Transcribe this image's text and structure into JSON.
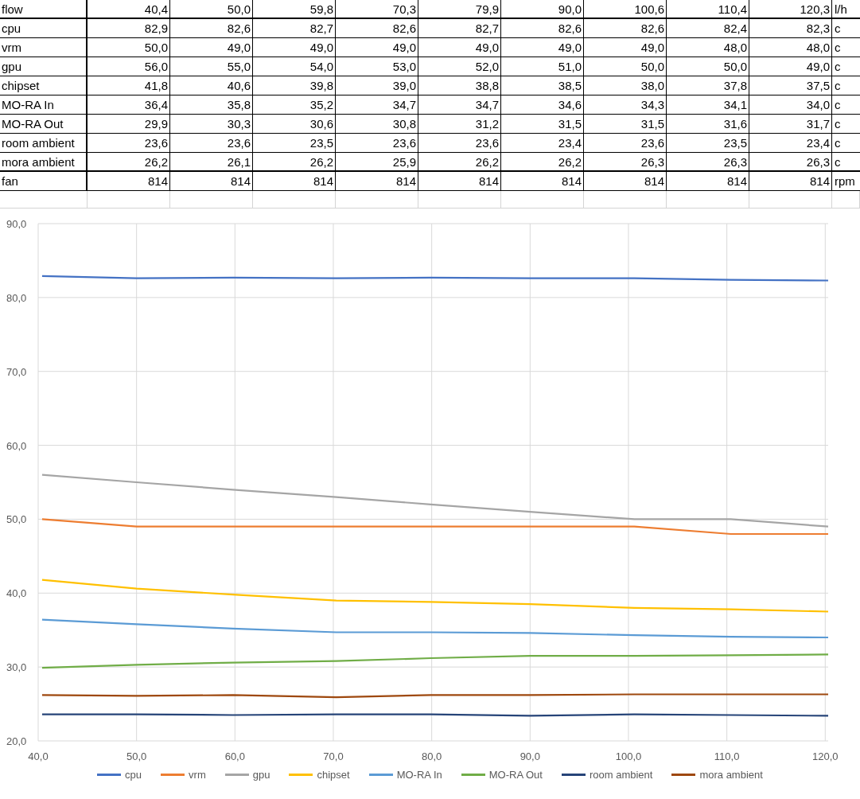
{
  "table": {
    "rows": [
      {
        "label": "flow",
        "values": [
          "40,4",
          "50,0",
          "59,8",
          "70,3",
          "79,9",
          "90,0",
          "100,6",
          "110,4",
          "120,3"
        ],
        "unit": "l/h"
      },
      {
        "label": "cpu",
        "values": [
          "82,9",
          "82,6",
          "82,7",
          "82,6",
          "82,7",
          "82,6",
          "82,6",
          "82,4",
          "82,3"
        ],
        "unit": "c"
      },
      {
        "label": "vrm",
        "values": [
          "50,0",
          "49,0",
          "49,0",
          "49,0",
          "49,0",
          "49,0",
          "49,0",
          "48,0",
          "48,0"
        ],
        "unit": "c"
      },
      {
        "label": "gpu",
        "values": [
          "56,0",
          "55,0",
          "54,0",
          "53,0",
          "52,0",
          "51,0",
          "50,0",
          "50,0",
          "49,0"
        ],
        "unit": "c"
      },
      {
        "label": "chipset",
        "values": [
          "41,8",
          "40,6",
          "39,8",
          "39,0",
          "38,8",
          "38,5",
          "38,0",
          "37,8",
          "37,5"
        ],
        "unit": "c"
      },
      {
        "label": "MO-RA In",
        "values": [
          "36,4",
          "35,8",
          "35,2",
          "34,7",
          "34,7",
          "34,6",
          "34,3",
          "34,1",
          "34,0"
        ],
        "unit": "c"
      },
      {
        "label": "MO-RA Out",
        "values": [
          "29,9",
          "30,3",
          "30,6",
          "30,8",
          "31,2",
          "31,5",
          "31,5",
          "31,6",
          "31,7"
        ],
        "unit": "c"
      },
      {
        "label": "room ambient",
        "values": [
          "23,6",
          "23,6",
          "23,5",
          "23,6",
          "23,6",
          "23,4",
          "23,6",
          "23,5",
          "23,4"
        ],
        "unit": "c"
      },
      {
        "label": "mora ambient",
        "values": [
          "26,2",
          "26,1",
          "26,2",
          "25,9",
          "26,2",
          "26,2",
          "26,3",
          "26,3",
          "26,3"
        ],
        "unit": "c"
      },
      {
        "label": "fan",
        "values": [
          "814",
          "814",
          "814",
          "814",
          "814",
          "814",
          "814",
          "814",
          "814"
        ],
        "unit": "rpm"
      }
    ]
  },
  "chart": {
    "chart_data": {
      "type": "line",
      "x": [
        40.4,
        50.0,
        59.8,
        70.3,
        79.9,
        90.0,
        100.6,
        110.4,
        120.3
      ],
      "xlim": [
        40,
        120.3
      ],
      "ylim": [
        20,
        90
      ],
      "grid": true,
      "legend": true,
      "xticks": [
        {
          "value": 40,
          "label": "40,0"
        },
        {
          "value": 50,
          "label": "50,0"
        },
        {
          "value": 60,
          "label": "60,0"
        },
        {
          "value": 70,
          "label": "70,0"
        },
        {
          "value": 80,
          "label": "80,0"
        },
        {
          "value": 90,
          "label": "90,0"
        },
        {
          "value": 100,
          "label": "100,0"
        },
        {
          "value": 110,
          "label": "110,0"
        },
        {
          "value": 120,
          "label": "120,0"
        }
      ],
      "yticks": [
        {
          "value": 20,
          "label": "20,0"
        },
        {
          "value": 30,
          "label": "30,0"
        },
        {
          "value": 40,
          "label": "40,0"
        },
        {
          "value": 50,
          "label": "50,0"
        },
        {
          "value": 60,
          "label": "60,0"
        },
        {
          "value": 70,
          "label": "70,0"
        },
        {
          "value": 80,
          "label": "80,0"
        },
        {
          "value": 90,
          "label": "90,0"
        }
      ],
      "series": [
        {
          "name": "cpu",
          "color": "#4472c4",
          "values": [
            82.9,
            82.6,
            82.7,
            82.6,
            82.7,
            82.6,
            82.6,
            82.4,
            82.3
          ]
        },
        {
          "name": "vrm",
          "color": "#ed7d31",
          "values": [
            50.0,
            49.0,
            49.0,
            49.0,
            49.0,
            49.0,
            49.0,
            48.0,
            48.0
          ]
        },
        {
          "name": "gpu",
          "color": "#a5a5a5",
          "values": [
            56.0,
            55.0,
            54.0,
            53.0,
            52.0,
            51.0,
            50.0,
            50.0,
            49.0
          ]
        },
        {
          "name": "chipset",
          "color": "#ffc000",
          "values": [
            41.8,
            40.6,
            39.8,
            39.0,
            38.8,
            38.5,
            38.0,
            37.8,
            37.5
          ]
        },
        {
          "name": "MO-RA In",
          "color": "#5b9bd5",
          "values": [
            36.4,
            35.8,
            35.2,
            34.7,
            34.7,
            34.6,
            34.3,
            34.1,
            34.0
          ]
        },
        {
          "name": "MO-RA Out",
          "color": "#70ad47",
          "values": [
            29.9,
            30.3,
            30.6,
            30.8,
            31.2,
            31.5,
            31.5,
            31.6,
            31.7
          ]
        },
        {
          "name": "room ambient",
          "color": "#264478",
          "values": [
            23.6,
            23.6,
            23.5,
            23.6,
            23.6,
            23.4,
            23.6,
            23.5,
            23.4
          ]
        },
        {
          "name": "mora ambient",
          "color": "#9e480e",
          "values": [
            26.2,
            26.1,
            26.2,
            25.9,
            26.2,
            26.2,
            26.3,
            26.3,
            26.3
          ]
        }
      ]
    }
  }
}
